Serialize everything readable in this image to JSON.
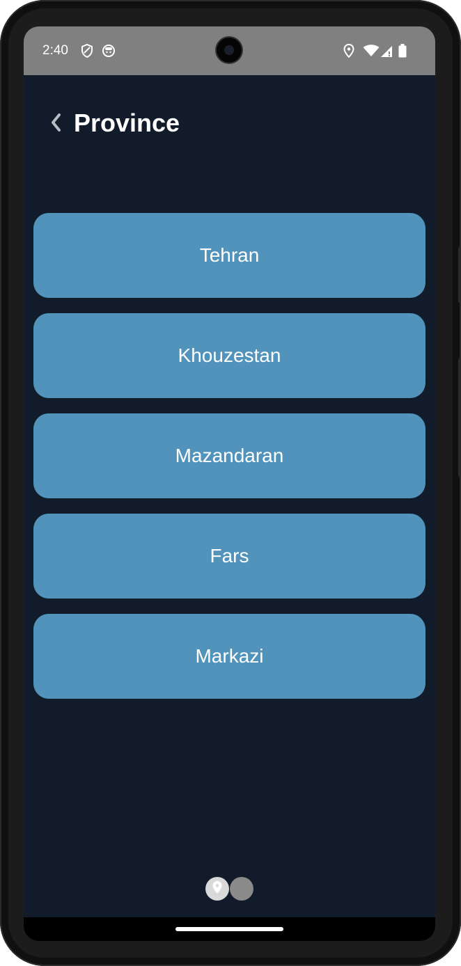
{
  "status_bar": {
    "time": "2:40",
    "left_icons": [
      "shield-icon",
      "face-icon"
    ],
    "right_icons": [
      "location-icon",
      "wifi-icon",
      "signal-icon",
      "battery-icon"
    ]
  },
  "header": {
    "title": "Province",
    "back_icon": "chevron-left-icon"
  },
  "provinces": [
    "Tehran",
    "Khouzestan",
    "Mazandaran",
    "Fars",
    "Markazi"
  ],
  "colors": {
    "background": "#111b29",
    "button": "#5193bb",
    "status_bar": "#808080",
    "text": "#ffffff"
  }
}
